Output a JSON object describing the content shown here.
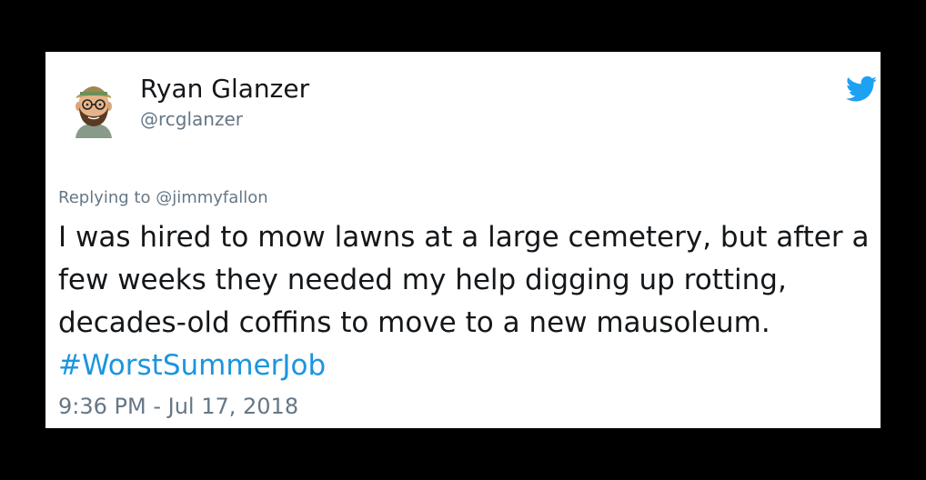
{
  "tweet": {
    "author_name": "Ryan Glanzer",
    "author_handle": "@rcglanzer",
    "replying_prefix": "Replying to ",
    "replying_to": "@jimmyfallon",
    "text": "I was hired to mow lawns at a large cemetery, but after a few weeks they needed my help digging up rotting, decades-old coffins to move to a new mausoleum. ",
    "hashtag": "#WorstSummerJob",
    "timestamp": "9:36 PM - Jul 17, 2018"
  },
  "icons": {
    "avatar": "bearded-man-avatar",
    "brand": "twitter-bird-icon"
  },
  "colors": {
    "background": "#000000",
    "card": "#ffffff",
    "text": "#14171a",
    "muted": "#657786",
    "link": "#1b95e0",
    "brand": "#1da1f2"
  }
}
